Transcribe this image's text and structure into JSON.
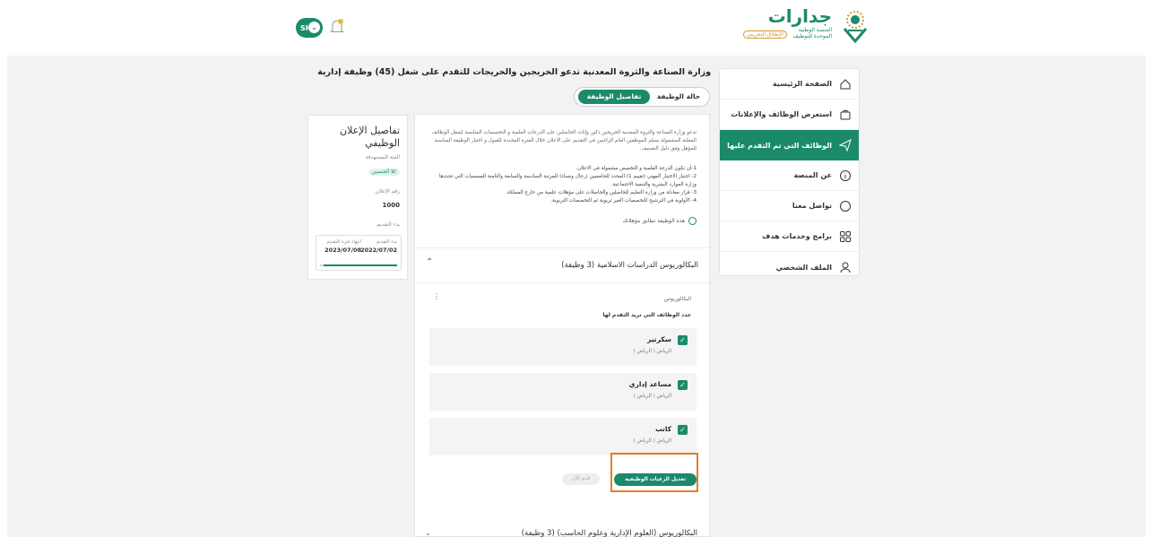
{
  "header": {
    "logo_title": "جدارات",
    "logo_sub_line1": "المنصة الوطنية",
    "logo_sub_line2": "الموحدة للتوظيف",
    "logo_badge": "الإطلاق التجريبي",
    "avatar_initials": "SH"
  },
  "sidebar": {
    "items": [
      {
        "label": "الصفحة الرئيسية",
        "icon": "home-icon"
      },
      {
        "label": "استعرض الوظائف والإعلانات",
        "icon": "briefcase-icon"
      },
      {
        "label": "الوظائف التي تم التقدم عليها",
        "icon": "send-icon"
      },
      {
        "label": "عن المنصة",
        "icon": "info-icon"
      },
      {
        "label": "تواصل معنا",
        "icon": "chat-icon"
      },
      {
        "label": "برامج وخدمات هدف",
        "icon": "grid-icon"
      },
      {
        "label": "الملف الشخصي",
        "icon": "user-icon"
      }
    ],
    "active_index": 2
  },
  "page": {
    "title": "وزارة الصناعة والثروة المعدنية تدعو الخريجين والخريجات للتقدم على شغل (45) وظيفة إدارية",
    "tabs": {
      "status": "حالة الوظيفة",
      "details": "تفاصيل الوظيفة"
    },
    "description": "تدعو وزارة الصناعة والثروة المعدنية الخريجين ذكور وإناث الحاصلين على الدرجات العلمية و التخصصات المناسبة لشغل الوظائف المعلنة المشمولة بسلم الموظفين العام الراغبين في التقديم على الاعلان خلال الفترة المحددة للقبول و اختيار الوظيفة المناسبة للمؤهل وفق دليل التصنيف.",
    "requirements": [
      "1-أن تكون الدرجة العلمية و التخصص مشمولة في الاعلان.",
      "2- اجتياز الاختبار المهني (تقييم 1) المحدد للجامعيين (رجال ونساء) للمرتبة السادسة والسابعة والثامنة للمسميات التي تحددها وزارة الموارد البشرية والتنمية الاجتماعية.",
      "3- قرار معادلة من وزارة التعليم للحاصلين والحاصلات على مؤهلات علمية من خارج المملكة.",
      "4- الأولوية في الترشيح للتخصصات الغير تربوية ثم التخصصات التربوية."
    ],
    "qualification_note": "هذه الوظيفة تطابق مؤهلاتك"
  },
  "accordion": {
    "title": "البكالوريوس الدراسات الاسلامية (3 وظيفة)",
    "degree_label": "البكالوريوس",
    "choose_label": "حدد الوظائف التي تريد التقدم لها",
    "jobs": [
      {
        "title": "سكرتير",
        "location": "الرياض ( الرياض )"
      },
      {
        "title": "مساعد إداري",
        "location": "الرياض ( الرياض )"
      },
      {
        "title": "كاتب",
        "location": "الرياض ( الرياض )"
      }
    ],
    "edit_button": "تعديل الرغبات الوظيفية",
    "apply_button": "قدم الآن",
    "next_title": "البكالوريوس (العلوم الإدارية وعلوم الحاسب) (3 وظيفة)"
  },
  "info": {
    "title": "تفاصيل الإعلان الوظيفي",
    "category_label": "الفئة المستهدفة",
    "category_value": "كلا الجنسين",
    "ad_number_label": "رقم الإعلان",
    "ad_number_value": "1000",
    "start_label": "بدء التقديم",
    "dates": {
      "start_label": "بدء التقديم",
      "start_value": "2022/07/02",
      "end_label": "انتهاء فترة التقديم",
      "end_value": "2023/07/08"
    },
    "progress_fraction": 0.95
  },
  "colors": {
    "brand": "#1b8a6b",
    "highlight": "#e87c1e"
  }
}
